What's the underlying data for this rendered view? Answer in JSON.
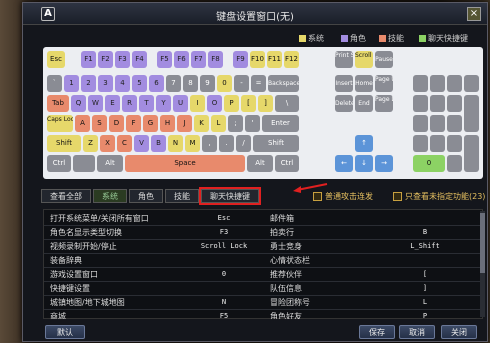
{
  "window": {
    "title": "键盘设置窗口(无)",
    "logo": "A"
  },
  "legend": [
    {
      "label": "系统",
      "color": "#e6d86a"
    },
    {
      "label": "角色",
      "color": "#a28ce0"
    },
    {
      "label": "技能",
      "color": "#e88a6c"
    },
    {
      "label": "聊天快捷键",
      "color": "#8cd264"
    }
  ],
  "keys": {
    "esc": "Esc",
    "f": [
      "F1",
      "F2",
      "F3",
      "F4",
      "F5",
      "F6",
      "F7",
      "F8",
      "F9",
      "F10",
      "F11",
      "F12"
    ],
    "prt": "Print Scrn",
    "scroll": "Scroll Lock",
    "pause": "Pause",
    "num": [
      "`",
      "1",
      "2",
      "3",
      "4",
      "5",
      "6",
      "7",
      "8",
      "9",
      "0",
      "-",
      "="
    ],
    "backspace": "Backspace",
    "insert": "Insert",
    "home": "Home",
    "pgup": "Page Up",
    "tab": "Tab",
    "qrow": [
      "Q",
      "W",
      "E",
      "R",
      "T",
      "Y",
      "U",
      "I",
      "O",
      "P",
      "[",
      "]",
      "\\"
    ],
    "delete": "Delete",
    "end": "End",
    "pgdn": "Page Down",
    "caps": "Caps Lock",
    "arow": [
      "A",
      "S",
      "D",
      "F",
      "G",
      "H",
      "J",
      "K",
      "L",
      ";",
      "'"
    ],
    "enter": "Enter",
    "shift": "Shift",
    "zrow": [
      "Z",
      "X",
      "C",
      "V",
      "B",
      "N",
      "M",
      ",",
      ".",
      "/"
    ],
    "ctrl": "Ctrl",
    "alt": "Alt",
    "space": "Space",
    "up": "↑",
    "left": "←",
    "down": "↓",
    "right": "→",
    "numpad0": "0"
  },
  "filters": [
    "查看全部",
    "系统",
    "角色",
    "技能",
    "聊天快捷键"
  ],
  "checkbox1": "普通攻击连发",
  "checkbox2": "只查看未指定功能(23)",
  "bindings_left": [
    {
      "name": "打开系统菜单/关闭所有窗口",
      "key": "Esc"
    },
    {
      "name": "角色名显示类型切换",
      "key": "F3"
    },
    {
      "name": "视频录制开始/停止",
      "key": "Scroll Lock"
    },
    {
      "name": "装备辞典",
      "key": ""
    },
    {
      "name": "游戏设置窗口",
      "key": "0"
    },
    {
      "name": "快捷键设置",
      "key": ""
    },
    {
      "name": "城镇地图/地下城地图",
      "key": "N"
    },
    {
      "name": "商城",
      "key": "F5"
    }
  ],
  "bindings_right": [
    {
      "name": "邮件箱",
      "key": ""
    },
    {
      "name": "拍卖行",
      "key": "B"
    },
    {
      "name": "勇士竞身",
      "key": "L_Shift"
    },
    {
      "name": "心情状态栏",
      "key": ""
    },
    {
      "name": "推荐伙伴",
      "key": "["
    },
    {
      "name": "队伍信息",
      "key": "]"
    },
    {
      "name": "冒险团称号",
      "key": "L"
    },
    {
      "name": "角色好友",
      "key": "P"
    }
  ],
  "buttons": {
    "default": "默认",
    "save": "保存",
    "cancel": "取消",
    "close": "关闭"
  }
}
